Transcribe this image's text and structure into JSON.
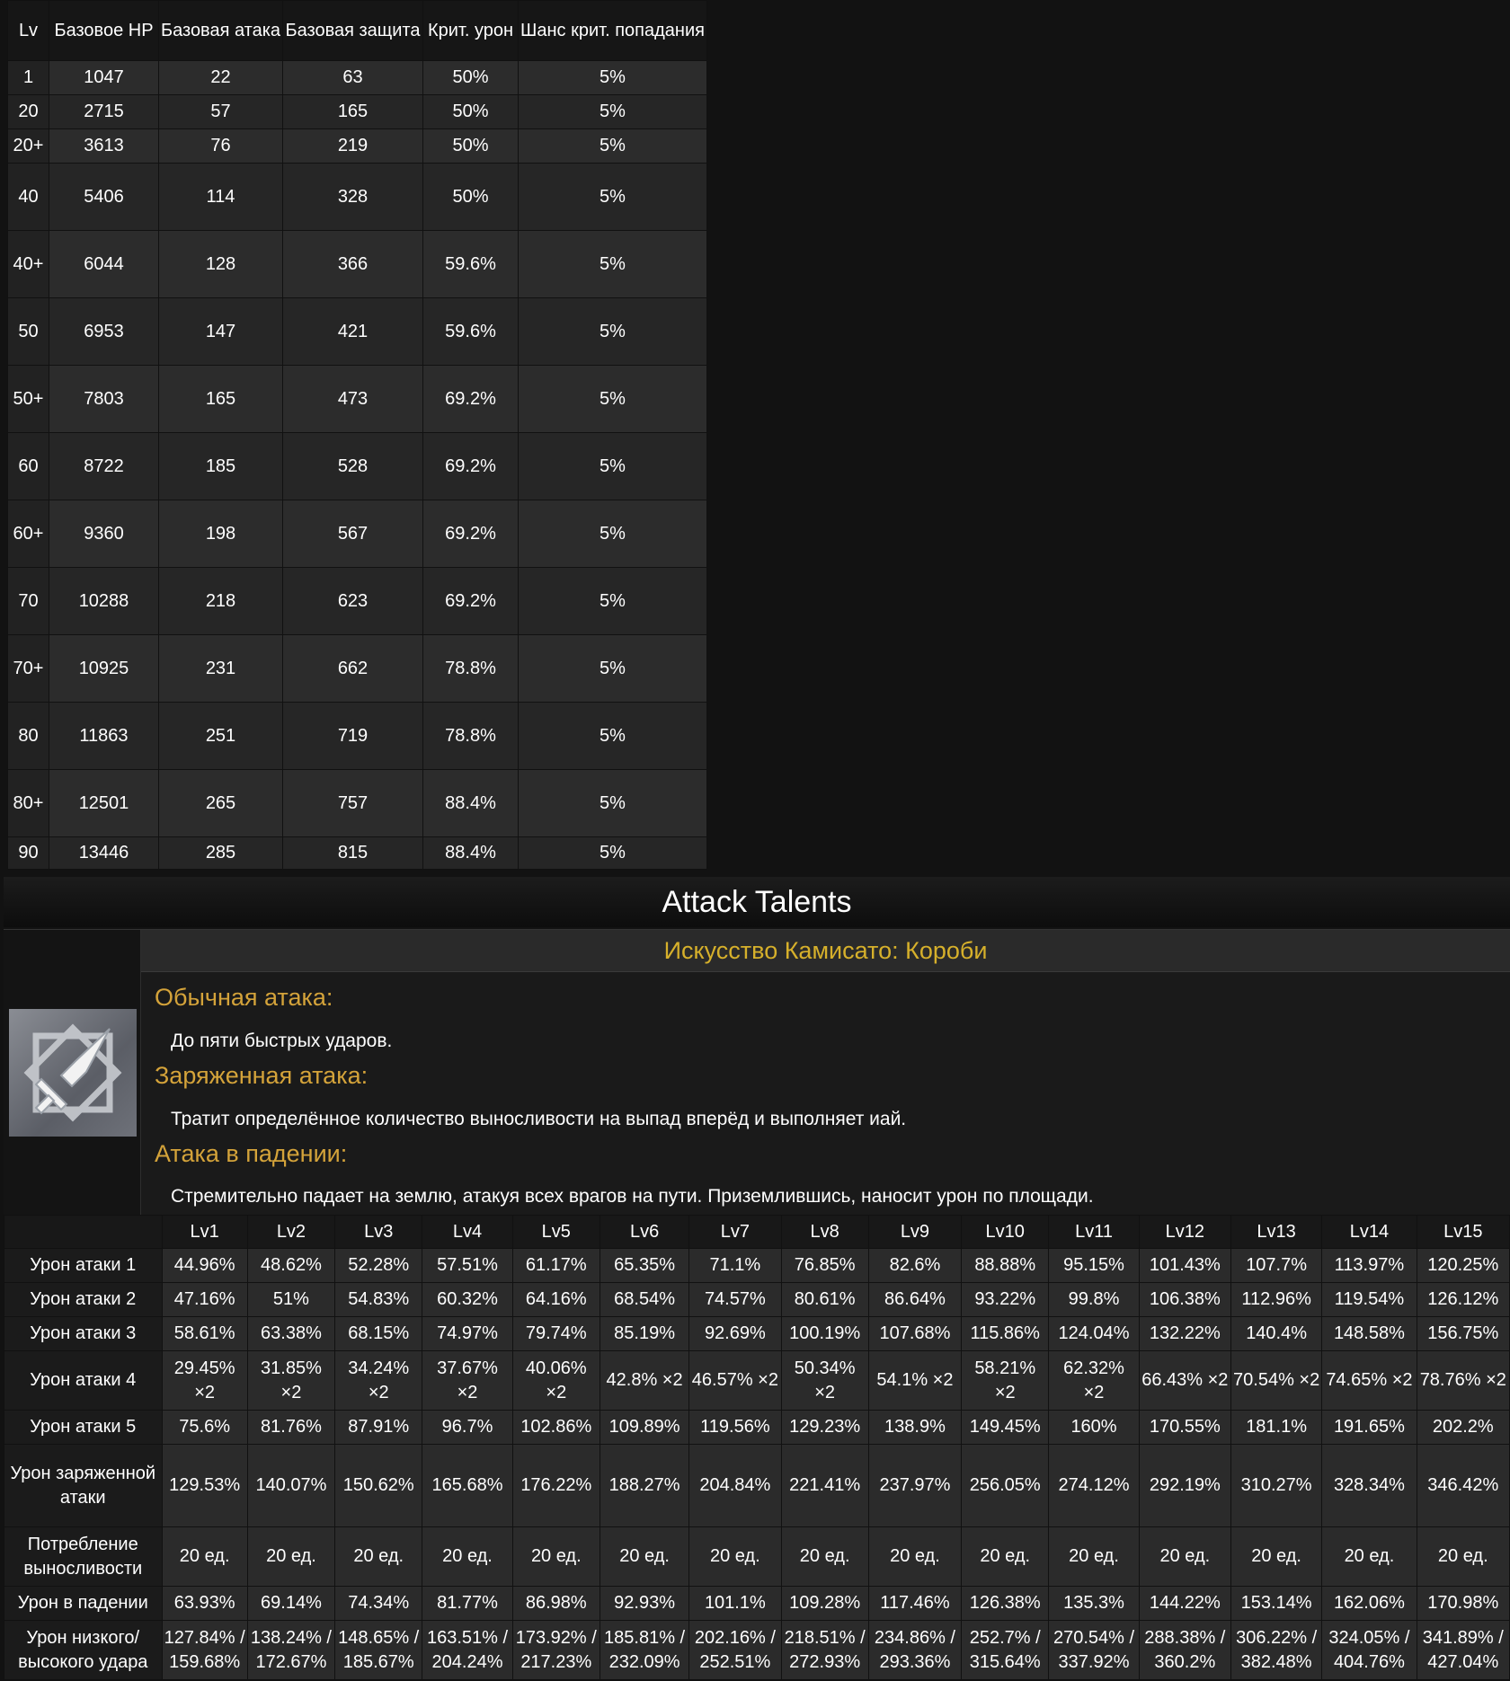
{
  "stats_table": {
    "headers": [
      "Lv",
      "Базовое HP",
      "Базовая атака",
      "Базовая защита",
      "Крит. урон",
      "Шанс крит. попадания"
    ],
    "rows": [
      [
        "1",
        "1047",
        "22",
        "63",
        "50%",
        "5%"
      ],
      [
        "20",
        "2715",
        "57",
        "165",
        "50%",
        "5%"
      ],
      [
        "20+",
        "3613",
        "76",
        "219",
        "50%",
        "5%"
      ],
      [
        "40",
        "5406",
        "114",
        "328",
        "50%",
        "5%"
      ],
      [
        "40+",
        "6044",
        "128",
        "366",
        "59.6%",
        "5%"
      ],
      [
        "50",
        "6953",
        "147",
        "421",
        "59.6%",
        "5%"
      ],
      [
        "50+",
        "7803",
        "165",
        "473",
        "69.2%",
        "5%"
      ],
      [
        "60",
        "8722",
        "185",
        "528",
        "69.2%",
        "5%"
      ],
      [
        "60+",
        "9360",
        "198",
        "567",
        "69.2%",
        "5%"
      ],
      [
        "70",
        "10288",
        "218",
        "623",
        "69.2%",
        "5%"
      ],
      [
        "70+",
        "10925",
        "231",
        "662",
        "78.8%",
        "5%"
      ],
      [
        "80",
        "11863",
        "251",
        "719",
        "78.8%",
        "5%"
      ],
      [
        "80+",
        "12501",
        "265",
        "757",
        "88.4%",
        "5%"
      ],
      [
        "90",
        "13446",
        "285",
        "815",
        "88.4%",
        "5%"
      ]
    ]
  },
  "talents": {
    "header": "Attack Talents",
    "icon": "sword-crest-icon",
    "name": "Искусство Камисато: Короби",
    "sections": [
      {
        "title": "Обычная атака:",
        "text": "До пяти быстрых ударов."
      },
      {
        "title": "Заряженная атака:",
        "text": "Тратит определённое количество выносливости на выпад вперёд и выполняет иай."
      },
      {
        "title": "Атака в падении:",
        "text": "Стремительно падает на землю, атакуя всех врагов на пути. Приземлившись, наносит урон по площади."
      }
    ]
  },
  "levels_table": {
    "headers": [
      "",
      "Lv1",
      "Lv2",
      "Lv3",
      "Lv4",
      "Lv5",
      "Lv6",
      "Lv7",
      "Lv8",
      "Lv9",
      "Lv10",
      "Lv11",
      "Lv12",
      "Lv13",
      "Lv14",
      "Lv15"
    ],
    "rows": [
      [
        "Урон атаки 1",
        "44.96%",
        "48.62%",
        "52.28%",
        "57.51%",
        "61.17%",
        "65.35%",
        "71.1%",
        "76.85%",
        "82.6%",
        "88.88%",
        "95.15%",
        "101.43%",
        "107.7%",
        "113.97%",
        "120.25%"
      ],
      [
        "Урон атаки 2",
        "47.16%",
        "51%",
        "54.83%",
        "60.32%",
        "64.16%",
        "68.54%",
        "74.57%",
        "80.61%",
        "86.64%",
        "93.22%",
        "99.8%",
        "106.38%",
        "112.96%",
        "119.54%",
        "126.12%"
      ],
      [
        "Урон атаки 3",
        "58.61%",
        "63.38%",
        "68.15%",
        "74.97%",
        "79.74%",
        "85.19%",
        "92.69%",
        "100.19%",
        "107.68%",
        "115.86%",
        "124.04%",
        "132.22%",
        "140.4%",
        "148.58%",
        "156.75%"
      ],
      [
        "Урон атаки 4",
        "29.45% ×2",
        "31.85% ×2",
        "34.24% ×2",
        "37.67% ×2",
        "40.06% ×2",
        "42.8% ×2",
        "46.57% ×2",
        "50.34% ×2",
        "54.1% ×2",
        "58.21% ×2",
        "62.32% ×2",
        "66.43% ×2",
        "70.54% ×2",
        "74.65% ×2",
        "78.76% ×2"
      ],
      [
        "Урон атаки 5",
        "75.6%",
        "81.76%",
        "87.91%",
        "96.7%",
        "102.86%",
        "109.89%",
        "119.56%",
        "129.23%",
        "138.9%",
        "149.45%",
        "160%",
        "170.55%",
        "181.1%",
        "191.65%",
        "202.2%"
      ],
      [
        "Урон заряженной атаки",
        "129.53%",
        "140.07%",
        "150.62%",
        "165.68%",
        "176.22%",
        "188.27%",
        "204.84%",
        "221.41%",
        "237.97%",
        "256.05%",
        "274.12%",
        "292.19%",
        "310.27%",
        "328.34%",
        "346.42%"
      ],
      [
        "Потребление выносливости",
        "20 ед.",
        "20 ед.",
        "20 ед.",
        "20 ед.",
        "20 ед.",
        "20 ед.",
        "20 ед.",
        "20 ед.",
        "20 ед.",
        "20 ед.",
        "20 ед.",
        "20 ед.",
        "20 ед.",
        "20 ед.",
        "20 ед."
      ],
      [
        "Урон в падении",
        "63.93%",
        "69.14%",
        "74.34%",
        "81.77%",
        "86.98%",
        "92.93%",
        "101.1%",
        "109.28%",
        "117.46%",
        "126.38%",
        "135.3%",
        "144.22%",
        "153.14%",
        "162.06%",
        "170.98%"
      ],
      [
        "Урон низкого/ высокого удара",
        "127.84% / 159.68%",
        "138.24% / 172.67%",
        "148.65% / 185.67%",
        "163.51% / 204.24%",
        "173.92% / 217.23%",
        "185.81% / 232.09%",
        "202.16% / 252.51%",
        "218.51% / 272.93%",
        "234.86% / 293.36%",
        "252.7% / 315.64%",
        "270.54% / 337.92%",
        "288.38% / 360.2%",
        "306.22% / 382.48%",
        "324.05% / 404.76%",
        "341.89% / 427.04%"
      ]
    ]
  }
}
